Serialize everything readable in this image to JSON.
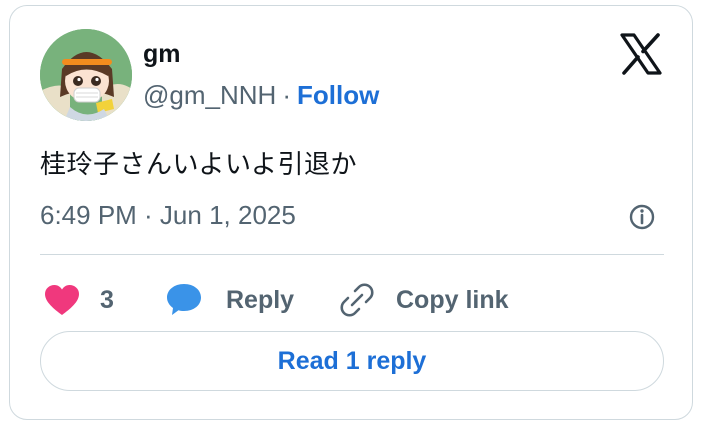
{
  "author": {
    "name": "gm",
    "handle": "@gm_NNH",
    "separator": "·",
    "follow_label": "Follow"
  },
  "tweet": {
    "text": "桂玲子さんいよいよ引退か",
    "timestamp": "6:49 PM · Jun 1, 2025"
  },
  "actions": {
    "like_count": "3",
    "reply_label": "Reply",
    "copy_link_label": "Copy link"
  },
  "read_replies_label": "Read 1 reply",
  "icons": {
    "brand": "x-logo-icon",
    "info": "info-icon",
    "like": "heart-icon",
    "reply": "speech-bubble-icon",
    "copy": "link-icon"
  },
  "colors": {
    "like": "#f91880",
    "reply": "#1d9bf0",
    "link": "#1d6fd6",
    "muted": "#536471",
    "text": "#0f1419",
    "border": "#cfd9de"
  }
}
